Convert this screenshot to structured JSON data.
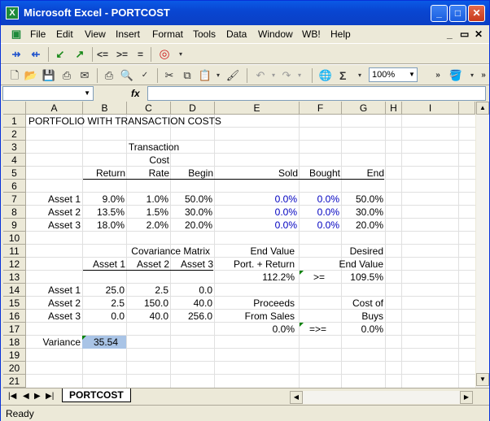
{
  "window": {
    "title": "Microsoft Excel - PORTCOST",
    "app_icon": "X",
    "min": "_",
    "max": "□",
    "close": "✕"
  },
  "menu": {
    "items": [
      "File",
      "Edit",
      "View",
      "Insert",
      "Format",
      "Tools",
      "Data",
      "Window",
      "WB!",
      "Help"
    ],
    "doc_controls": [
      "_",
      "▭",
      "✕"
    ]
  },
  "toolbar1": {
    "icons": [
      "trace-precedents-icon",
      "trace-dependents-icon",
      "check-icon",
      "arrow-icon",
      "target-icon"
    ],
    "ops": [
      "<=",
      ">=",
      "="
    ]
  },
  "toolbar2": {
    "zoom": "100%",
    "sigma": "Σ"
  },
  "formula_bar": {
    "fx": "fx",
    "name_box": "",
    "content": ""
  },
  "columns": [
    "A",
    "B",
    "C",
    "D",
    "E",
    "F",
    "G",
    "H",
    "I"
  ],
  "rows": [
    "1",
    "2",
    "3",
    "4",
    "5",
    "6",
    "7",
    "8",
    "9",
    "10",
    "11",
    "12",
    "13",
    "14",
    "15",
    "16",
    "17",
    "18",
    "19",
    "20",
    "21"
  ],
  "cells": {
    "title": "PORTFOLIO WITH TRANSACTION COSTS",
    "hdr_transaction": "Transaction",
    "hdr_cost": "Cost",
    "hdr_return": "Return",
    "hdr_rate": "Rate",
    "hdr_begin": "Begin",
    "hdr_sold": "Sold",
    "hdr_bought": "Bought",
    "hdr_end": "End",
    "assets": [
      {
        "name": "Asset 1",
        "ret": "9.0%",
        "rate": "1.0%",
        "begin": "50.0%",
        "sold": "0.0%",
        "bought": "0.0%",
        "end": "50.0%"
      },
      {
        "name": "Asset 2",
        "ret": "13.5%",
        "rate": "1.5%",
        "begin": "30.0%",
        "sold": "0.0%",
        "bought": "0.0%",
        "end": "30.0%"
      },
      {
        "name": "Asset 3",
        "ret": "18.0%",
        "rate": "2.0%",
        "begin": "20.0%",
        "sold": "0.0%",
        "bought": "0.0%",
        "end": "20.0%"
      }
    ],
    "cov_title": "Covariance Matrix",
    "cov_headers": [
      "Asset 1",
      "Asset 2",
      "Asset 3"
    ],
    "cov_rows": [
      {
        "name": "Asset 1",
        "v": [
          "25.0",
          "2.5",
          "0.0"
        ]
      },
      {
        "name": "Asset 2",
        "v": [
          "2.5",
          "150.0",
          "40.0"
        ]
      },
      {
        "name": "Asset 3",
        "v": [
          "0.0",
          "40.0",
          "256.0"
        ]
      }
    ],
    "end_value": "End Value",
    "port_return": "Port. + Return",
    "port_value": "112.2%",
    "gte": ">=",
    "desired": "Desired",
    "desired_end_value": "End Value",
    "desired_value": "109.5%",
    "proceeds": "Proceeds",
    "from_sales": "From Sales",
    "proceeds_value": "0.0%",
    "arrow_gte": "=>=",
    "cost_of": "Cost of",
    "buys": "Buys",
    "buys_value": "0.0%",
    "variance_label": "Variance",
    "variance_value": "35.54"
  },
  "sheet_tab": "PORTCOST",
  "status": "Ready"
}
